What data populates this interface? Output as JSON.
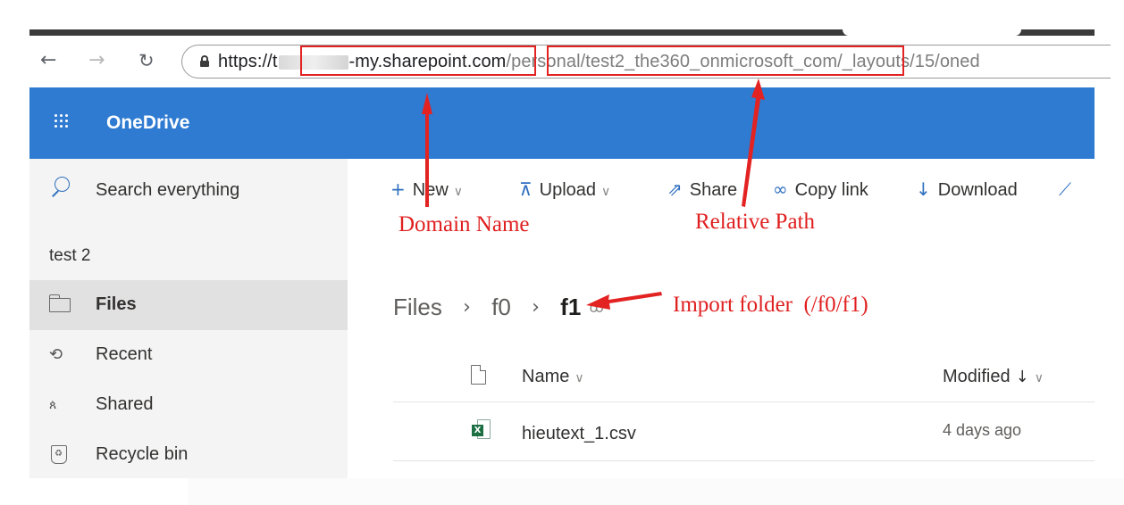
{
  "browser": {
    "back_icon": "arrow-left-icon",
    "forward_icon": "arrow-right-icon",
    "reload_icon": "reload-icon",
    "url_prefix": "https://t",
    "url_domain_rest": "-my.sharepoint.com",
    "url_path": "/personal/test2_the360_onmicrosoft_com/_layouts/15/oned"
  },
  "app": {
    "title": "OneDrive",
    "launcher_icon": "waffle-icon",
    "header_color": "#2f7bd1"
  },
  "sidebar": {
    "search_label": "Search everything",
    "user_name": "test 2",
    "items": [
      {
        "label": "Files",
        "icon": "folder-icon",
        "active": true
      },
      {
        "label": "Recent",
        "icon": "history-icon",
        "active": false
      },
      {
        "label": "Shared",
        "icon": "people-icon",
        "active": false
      },
      {
        "label": "Recycle bin",
        "icon": "recycle-bin-icon",
        "active": false
      }
    ]
  },
  "commands": {
    "new": "New",
    "upload": "Upload",
    "share": "Share",
    "copy_link": "Copy link",
    "download": "Download"
  },
  "breadcrumb": {
    "items": [
      "Files",
      "f0",
      "f1"
    ]
  },
  "file_list": {
    "columns": {
      "name": "Name",
      "modified": "Modified"
    },
    "rows": [
      {
        "name": "hieutext_1.csv",
        "modified": "4 days ago",
        "icon": "excel-file-icon"
      }
    ]
  },
  "annotations": {
    "domain_label": "Domain Name",
    "path_label": "Relative Path",
    "folder_label": "Import folder  (/f0/f1)",
    "color": "#e01f1f"
  }
}
